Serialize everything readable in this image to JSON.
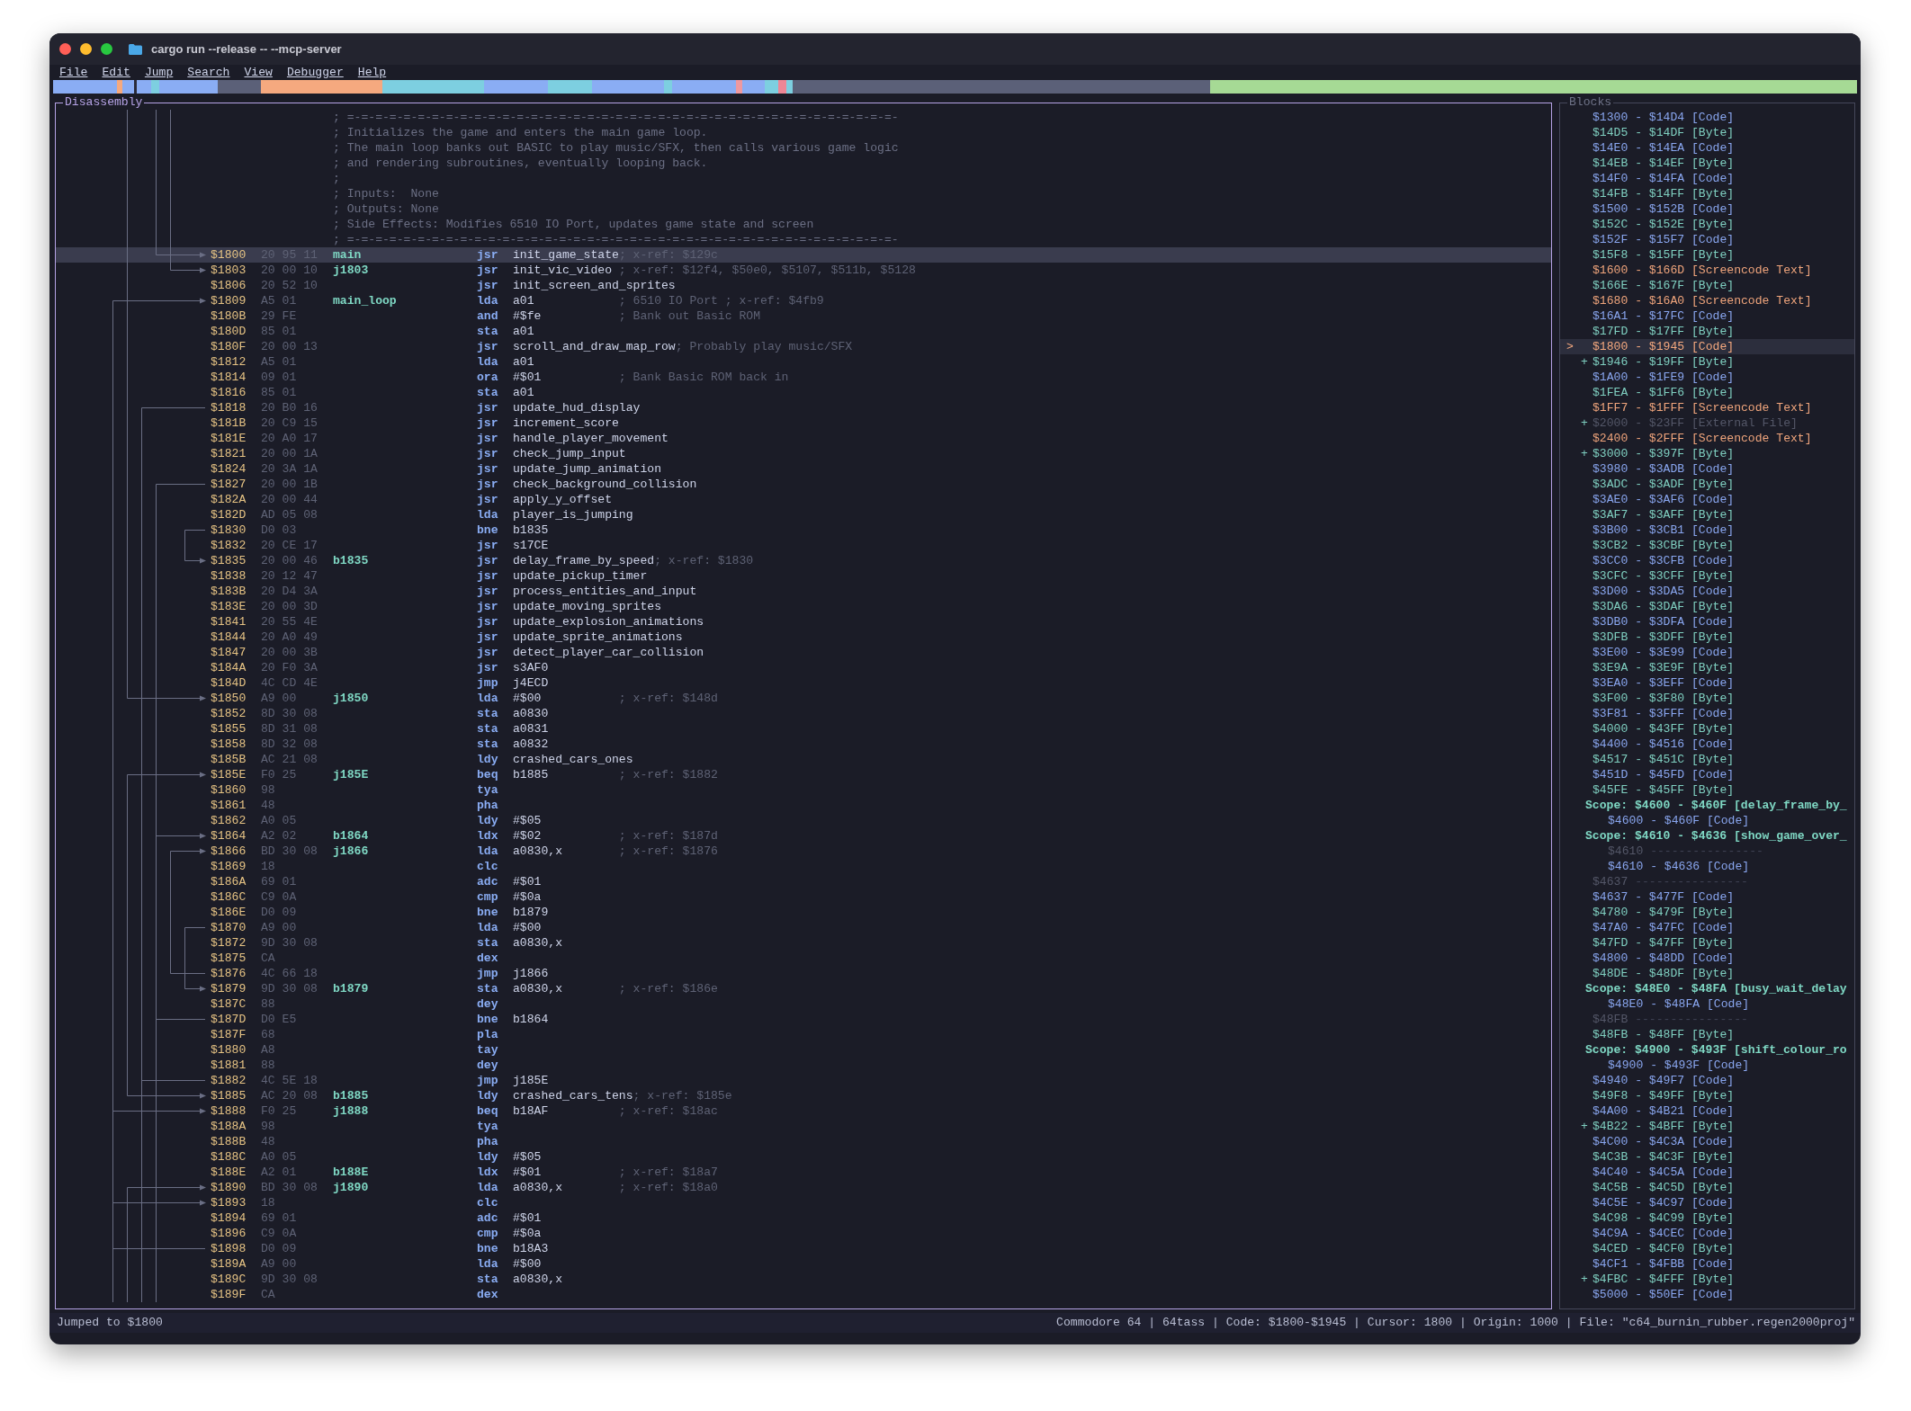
{
  "window": {
    "title": "cargo run --release -- --mcp-server"
  },
  "menu": [
    {
      "label": "File"
    },
    {
      "label": "Edit"
    },
    {
      "label": "Jump"
    },
    {
      "label": "Search"
    },
    {
      "label": "View"
    },
    {
      "label": "Debugger"
    },
    {
      "label": "Help"
    }
  ],
  "disassembly": {
    "title": "Disassembly",
    "lines": [
      {
        "kind": "comment",
        "text": "; =-=-=-=-=-=-=-=-=-=-=-=-=-=-=-=-=-=-=-=-=-=-=-=-=-=-=-=-=-=-=-=-=-=-=-=-=-=-=-"
      },
      {
        "kind": "comment",
        "text": "; Initializes the game and enters the main game loop."
      },
      {
        "kind": "comment",
        "text": "; The main loop banks out BASIC to play music/SFX, then calls various game logic"
      },
      {
        "kind": "comment",
        "text": "; and rendering subroutines, eventually looping back."
      },
      {
        "kind": "comment",
        "text": ";"
      },
      {
        "kind": "comment",
        "text": "; Inputs:  None"
      },
      {
        "kind": "comment",
        "text": "; Outputs: None"
      },
      {
        "kind": "comment",
        "text": "; Side Effects: Modifies 6510 IO Port, updates game state and screen"
      },
      {
        "kind": "comment",
        "text": "; =-=-=-=-=-=-=-=-=-=-=-=-=-=-=-=-=-=-=-=-=-=-=-=-=-=-=-=-=-=-=-=-=-=-=-=-=-=-=-"
      },
      {
        "kind": "code",
        "address": "$1800",
        "bytes": "20 95 11",
        "label": "main",
        "mnemonic": "jsr",
        "operand": "init_game_state",
        "comment": "; x-ref: $129c",
        "selected": true
      },
      {
        "kind": "code",
        "address": "$1803",
        "bytes": "20 00 10",
        "label": "j1803",
        "mnemonic": "jsr",
        "operand": "init_vic_video",
        "comment": "; x-ref: $12f4, $50e0, $5107, $511b, $5128",
        "selected": false
      },
      {
        "kind": "code",
        "address": "$1806",
        "bytes": "20 52 10",
        "mnemonic": "jsr",
        "operand": "init_screen_and_sprites",
        "selected": false
      },
      {
        "kind": "code",
        "address": "$1809",
        "bytes": "A5 01",
        "label": "main_loop",
        "mnemonic": "lda",
        "operand": "a01",
        "comment": "; 6510 IO Port ; x-ref: $4fb9",
        "selected": false
      },
      {
        "kind": "code",
        "address": "$180B",
        "bytes": "29 FE",
        "mnemonic": "and",
        "operand": "#$fe",
        "comment": "; Bank out Basic ROM",
        "selected": false
      },
      {
        "kind": "code",
        "address": "$180D",
        "bytes": "85 01",
        "mnemonic": "sta",
        "operand": "a01",
        "selected": false
      },
      {
        "kind": "code",
        "address": "$180F",
        "bytes": "20 00 13",
        "mnemonic": "jsr",
        "operand": "scroll_and_draw_map_row",
        "comment": "; Probably play music/SFX",
        "selected": false
      },
      {
        "kind": "code",
        "address": "$1812",
        "bytes": "A5 01",
        "mnemonic": "lda",
        "operand": "a01",
        "selected": false
      },
      {
        "kind": "code",
        "address": "$1814",
        "bytes": "09 01",
        "mnemonic": "ora",
        "operand": "#$01",
        "comment": "; Bank Basic ROM back in",
        "selected": false
      },
      {
        "kind": "code",
        "address": "$1816",
        "bytes": "85 01",
        "mnemonic": "sta",
        "operand": "a01",
        "selected": false
      },
      {
        "kind": "code",
        "address": "$1818",
        "bytes": "20 B0 16",
        "mnemonic": "jsr",
        "operand": "update_hud_display",
        "selected": false
      },
      {
        "kind": "code",
        "address": "$181B",
        "bytes": "20 C9 15",
        "mnemonic": "jsr",
        "operand": "increment_score",
        "selected": false
      },
      {
        "kind": "code",
        "address": "$181E",
        "bytes": "20 A0 17",
        "mnemonic": "jsr",
        "operand": "handle_player_movement",
        "selected": false
      },
      {
        "kind": "code",
        "address": "$1821",
        "bytes": "20 00 1A",
        "mnemonic": "jsr",
        "operand": "check_jump_input",
        "selected": false
      },
      {
        "kind": "code",
        "address": "$1824",
        "bytes": "20 3A 1A",
        "mnemonic": "jsr",
        "operand": "update_jump_animation",
        "selected": false
      },
      {
        "kind": "code",
        "address": "$1827",
        "bytes": "20 00 1B",
        "mnemonic": "jsr",
        "operand": "check_background_collision",
        "selected": false
      },
      {
        "kind": "code",
        "address": "$182A",
        "bytes": "20 00 44",
        "mnemonic": "jsr",
        "operand": "apply_y_offset",
        "selected": false
      },
      {
        "kind": "code",
        "address": "$182D",
        "bytes": "AD 05 08",
        "mnemonic": "lda",
        "operand": "player_is_jumping",
        "selected": false
      },
      {
        "kind": "code",
        "address": "$1830",
        "bytes": "D0 03",
        "mnemonic": "bne",
        "operand": "b1835",
        "selected": false
      },
      {
        "kind": "code",
        "address": "$1832",
        "bytes": "20 CE 17",
        "mnemonic": "jsr",
        "operand": "s17CE",
        "selected": false
      },
      {
        "kind": "code",
        "address": "$1835",
        "bytes": "20 00 46",
        "label": "b1835",
        "mnemonic": "jsr",
        "operand": "delay_frame_by_speed",
        "comment": "; x-ref: $1830",
        "selected": false
      },
      {
        "kind": "code",
        "address": "$1838",
        "bytes": "20 12 47",
        "mnemonic": "jsr",
        "operand": "update_pickup_timer",
        "selected": false
      },
      {
        "kind": "code",
        "address": "$183B",
        "bytes": "20 D4 3A",
        "mnemonic": "jsr",
        "operand": "process_entities_and_input",
        "selected": false
      },
      {
        "kind": "code",
        "address": "$183E",
        "bytes": "20 00 3D",
        "mnemonic": "jsr",
        "operand": "update_moving_sprites",
        "selected": false
      },
      {
        "kind": "code",
        "address": "$1841",
        "bytes": "20 55 4E",
        "mnemonic": "jsr",
        "operand": "update_explosion_animations",
        "selected": false
      },
      {
        "kind": "code",
        "address": "$1844",
        "bytes": "20 A0 49",
        "mnemonic": "jsr",
        "operand": "update_sprite_animations",
        "selected": false
      },
      {
        "kind": "code",
        "address": "$1847",
        "bytes": "20 00 3B",
        "mnemonic": "jsr",
        "operand": "detect_player_car_collision",
        "selected": false
      },
      {
        "kind": "code",
        "address": "$184A",
        "bytes": "20 F0 3A",
        "mnemonic": "jsr",
        "operand": "s3AF0",
        "selected": false
      },
      {
        "kind": "code",
        "address": "$184D",
        "bytes": "4C CD 4E",
        "mnemonic": "jmp",
        "operand": "j4ECD",
        "selected": false
      },
      {
        "kind": "code",
        "address": "$1850",
        "bytes": "A9 00",
        "label": "j1850",
        "mnemonic": "lda",
        "operand": "#$00",
        "comment": "; x-ref: $148d",
        "selected": false
      },
      {
        "kind": "code",
        "address": "$1852",
        "bytes": "8D 30 08",
        "mnemonic": "sta",
        "operand": "a0830",
        "selected": false
      },
      {
        "kind": "code",
        "address": "$1855",
        "bytes": "8D 31 08",
        "mnemonic": "sta",
        "operand": "a0831",
        "selected": false
      },
      {
        "kind": "code",
        "address": "$1858",
        "bytes": "8D 32 08",
        "mnemonic": "sta",
        "operand": "a0832",
        "selected": false
      },
      {
        "kind": "code",
        "address": "$185B",
        "bytes": "AC 21 08",
        "mnemonic": "ldy",
        "operand": "crashed_cars_ones",
        "selected": false
      },
      {
        "kind": "code",
        "address": "$185E",
        "bytes": "F0 25",
        "label": "j185E",
        "mnemonic": "beq",
        "operand": "b1885",
        "comment": "; x-ref: $1882",
        "selected": false
      },
      {
        "kind": "code",
        "address": "$1860",
        "bytes": "98",
        "mnemonic": "tya",
        "selected": false
      },
      {
        "kind": "code",
        "address": "$1861",
        "bytes": "48",
        "mnemonic": "pha",
        "selected": false
      },
      {
        "kind": "code",
        "address": "$1862",
        "bytes": "A0 05",
        "mnemonic": "ldy",
        "operand": "#$05",
        "selected": false
      },
      {
        "kind": "code",
        "address": "$1864",
        "bytes": "A2 02",
        "label": "b1864",
        "mnemonic": "ldx",
        "operand": "#$02",
        "comment": "; x-ref: $187d",
        "selected": false
      },
      {
        "kind": "code",
        "address": "$1866",
        "bytes": "BD 30 08",
        "label": "j1866",
        "mnemonic": "lda",
        "operand": "a0830,x",
        "comment": "; x-ref: $1876",
        "selected": false
      },
      {
        "kind": "code",
        "address": "$1869",
        "bytes": "18",
        "mnemonic": "clc",
        "selected": false
      },
      {
        "kind": "code",
        "address": "$186A",
        "bytes": "69 01",
        "mnemonic": "adc",
        "operand": "#$01",
        "selected": false
      },
      {
        "kind": "code",
        "address": "$186C",
        "bytes": "C9 0A",
        "mnemonic": "cmp",
        "operand": "#$0a",
        "selected": false
      },
      {
        "kind": "code",
        "address": "$186E",
        "bytes": "D0 09",
        "mnemonic": "bne",
        "operand": "b1879",
        "selected": false
      },
      {
        "kind": "code",
        "address": "$1870",
        "bytes": "A9 00",
        "mnemonic": "lda",
        "operand": "#$00",
        "selected": false
      },
      {
        "kind": "code",
        "address": "$1872",
        "bytes": "9D 30 08",
        "mnemonic": "sta",
        "operand": "a0830,x",
        "selected": false
      },
      {
        "kind": "code",
        "address": "$1875",
        "bytes": "CA",
        "mnemonic": "dex",
        "selected": false
      },
      {
        "kind": "code",
        "address": "$1876",
        "bytes": "4C 66 18",
        "mnemonic": "jmp",
        "operand": "j1866",
        "selected": false
      },
      {
        "kind": "code",
        "address": "$1879",
        "bytes": "9D 30 08",
        "label": "b1879",
        "mnemonic": "sta",
        "operand": "a0830,x",
        "comment": "; x-ref: $186e",
        "selected": false
      },
      {
        "kind": "code",
        "address": "$187C",
        "bytes": "88",
        "mnemonic": "dey",
        "selected": false
      },
      {
        "kind": "code",
        "address": "$187D",
        "bytes": "D0 E5",
        "mnemonic": "bne",
        "operand": "b1864",
        "selected": false
      },
      {
        "kind": "code",
        "address": "$187F",
        "bytes": "68",
        "mnemonic": "pla",
        "selected": false
      },
      {
        "kind": "code",
        "address": "$1880",
        "bytes": "A8",
        "mnemonic": "tay",
        "selected": false
      },
      {
        "kind": "code",
        "address": "$1881",
        "bytes": "88",
        "mnemonic": "dey",
        "selected": false
      },
      {
        "kind": "code",
        "address": "$1882",
        "bytes": "4C 5E 18",
        "mnemonic": "jmp",
        "operand": "j185E",
        "selected": false
      },
      {
        "kind": "code",
        "address": "$1885",
        "bytes": "AC 20 08",
        "label": "b1885",
        "mnemonic": "ldy",
        "operand": "crashed_cars_tens",
        "comment": "; x-ref: $185e",
        "selected": false
      },
      {
        "kind": "code",
        "address": "$1888",
        "bytes": "F0 25",
        "label": "j1888",
        "mnemonic": "beq",
        "operand": "b18AF",
        "comment": "; x-ref: $18ac",
        "selected": false
      },
      {
        "kind": "code",
        "address": "$188A",
        "bytes": "98",
        "mnemonic": "tya",
        "selected": false
      },
      {
        "kind": "code",
        "address": "$188B",
        "bytes": "48",
        "mnemonic": "pha",
        "selected": false
      },
      {
        "kind": "code",
        "address": "$188C",
        "bytes": "A0 05",
        "mnemonic": "ldy",
        "operand": "#$05",
        "selected": false
      },
      {
        "kind": "code",
        "address": "$188E",
        "bytes": "A2 01",
        "label": "b188E",
        "mnemonic": "ldx",
        "operand": "#$01",
        "comment": "; x-ref: $18a7",
        "selected": false
      },
      {
        "kind": "code",
        "address": "$1890",
        "bytes": "BD 30 08",
        "label": "j1890",
        "mnemonic": "lda",
        "operand": "a0830,x",
        "comment": "; x-ref: $18a0",
        "selected": false
      },
      {
        "kind": "code",
        "address": "$1893",
        "bytes": "18",
        "mnemonic": "clc",
        "selected": false
      },
      {
        "kind": "code",
        "address": "$1894",
        "bytes": "69 01",
        "mnemonic": "adc",
        "operand": "#$01",
        "selected": false
      },
      {
        "kind": "code",
        "address": "$1896",
        "bytes": "C9 0A",
        "mnemonic": "cmp",
        "operand": "#$0a",
        "selected": false
      },
      {
        "kind": "code",
        "address": "$1898",
        "bytes": "D0 09",
        "mnemonic": "bne",
        "operand": "b18A3",
        "selected": false
      },
      {
        "kind": "code",
        "address": "$189A",
        "bytes": "A9 00",
        "mnemonic": "lda",
        "operand": "#$00",
        "selected": false
      },
      {
        "kind": "code",
        "address": "$189C",
        "bytes": "9D 30 08",
        "mnemonic": "sta",
        "operand": "a0830,x",
        "selected": false
      },
      {
        "kind": "code",
        "address": "$189F",
        "bytes": "CA",
        "mnemonic": "dex",
        "selected": false
      }
    ]
  },
  "blocks": {
    "title": "Blocks",
    "items": [
      {
        "kind": "code",
        "text": "$1300 - $14D4 [Code]",
        "selected": false
      },
      {
        "kind": "byte",
        "text": "$14D5 - $14DF [Byte]",
        "selected": false
      },
      {
        "kind": "code",
        "text": "$14E0 - $14EA [Code]",
        "selected": false
      },
      {
        "kind": "byte",
        "text": "$14EB - $14EF [Byte]",
        "selected": false
      },
      {
        "kind": "code",
        "text": "$14F0 - $14FA [Code]",
        "selected": false
      },
      {
        "kind": "byte",
        "text": "$14FB - $14FF [Byte]",
        "selected": false
      },
      {
        "kind": "code",
        "text": "$1500 - $152B [Code]",
        "selected": false
      },
      {
        "kind": "byte",
        "text": "$152C - $152E [Byte]",
        "selected": false
      },
      {
        "kind": "code",
        "text": "$152F - $15F7 [Code]",
        "selected": false
      },
      {
        "kind": "byte",
        "text": "$15F8 - $15FF [Byte]",
        "selected": false
      },
      {
        "kind": "text",
        "text": "$1600 - $166D [Screencode Text]",
        "selected": false
      },
      {
        "kind": "byte",
        "text": "$166E - $167F [Byte]",
        "selected": false
      },
      {
        "kind": "text",
        "text": "$1680 - $16A0 [Screencode Text]",
        "selected": false
      },
      {
        "kind": "code",
        "text": "$16A1 - $17FC [Code]",
        "selected": false
      },
      {
        "kind": "byte",
        "text": "$17FD - $17FF [Byte]",
        "selected": false
      },
      {
        "kind": "code",
        "text": "$1800 - $1945 [Code]",
        "cursor": ">",
        "selected": true
      },
      {
        "kind": "byte",
        "text": "$1946 - $19FF [Byte]",
        "toggle": "+",
        "selected": false
      },
      {
        "kind": "code",
        "text": "$1A00 - $1FE9 [Code]",
        "selected": false
      },
      {
        "kind": "byte",
        "text": "$1FEA - $1FF6 [Byte]",
        "selected": false
      },
      {
        "kind": "text",
        "text": "$1FF7 - $1FFF [Screencode Text]",
        "selected": false
      },
      {
        "kind": "external",
        "text": "$2000 - $23FF [External File]",
        "toggle": "+",
        "selected": false
      },
      {
        "kind": "text",
        "text": "$2400 - $2FFF [Screencode Text]",
        "selected": false
      },
      {
        "kind": "byte",
        "text": "$3000 - $397F [Byte]",
        "toggle": "+",
        "selected": false
      },
      {
        "kind": "code",
        "text": "$3980 - $3ADB [Code]",
        "selected": false
      },
      {
        "kind": "byte",
        "text": "$3ADC - $3ADF [Byte]",
        "selected": false
      },
      {
        "kind": "code",
        "text": "$3AE0 - $3AF6 [Code]",
        "selected": false
      },
      {
        "kind": "byte",
        "text": "$3AF7 - $3AFF [Byte]",
        "selected": false
      },
      {
        "kind": "code",
        "text": "$3B00 - $3CB1 [Code]",
        "selected": false
      },
      {
        "kind": "byte",
        "text": "$3CB2 - $3CBF [Byte]",
        "selected": false
      },
      {
        "kind": "code",
        "text": "$3CC0 - $3CFB [Code]",
        "selected": false
      },
      {
        "kind": "byte",
        "text": "$3CFC - $3CFF [Byte]",
        "selected": false
      },
      {
        "kind": "code",
        "text": "$3D00 - $3DA5 [Code]",
        "selected": false
      },
      {
        "kind": "byte",
        "text": "$3DA6 - $3DAF [Byte]",
        "selected": false
      },
      {
        "kind": "code",
        "text": "$3DB0 - $3DFA [Code]",
        "selected": false
      },
      {
        "kind": "byte",
        "text": "$3DFB - $3DFF [Byte]",
        "selected": false
      },
      {
        "kind": "code",
        "text": "$3E00 - $3E99 [Code]",
        "selected": false
      },
      {
        "kind": "byte",
        "text": "$3E9A - $3E9F [Byte]",
        "selected": false
      },
      {
        "kind": "code",
        "text": "$3EA0 - $3EFF [Code]",
        "selected": false
      },
      {
        "kind": "byte",
        "text": "$3F00 - $3F80 [Byte]",
        "selected": false
      },
      {
        "kind": "code",
        "text": "$3F81 - $3FFF [Code]",
        "selected": false
      },
      {
        "kind": "byte",
        "text": "$4000 - $43FF [Byte]",
        "selected": false
      },
      {
        "kind": "code",
        "text": "$4400 - $4516 [Code]",
        "selected": false
      },
      {
        "kind": "byte",
        "text": "$4517 - $451C [Byte]",
        "selected": false
      },
      {
        "kind": "code",
        "text": "$451D - $45FD [Code]",
        "selected": false
      },
      {
        "kind": "byte",
        "text": "$45FE - $45FF [Byte]",
        "selected": false
      },
      {
        "kind": "scope",
        "text": "Scope: $4600 - $460F [delay_frame_by_",
        "selected": false,
        "children": [
          {
            "kind": "code",
            "text": "$4600 - $460F [Code]",
            "selected": false
          }
        ]
      },
      {
        "kind": "scope",
        "text": "Scope: $4610 - $4636 [show_game_over_",
        "selected": false,
        "children": [
          {
            "kind": "gap",
            "text": "$4610",
            "rule": "----------------",
            "selected": false
          },
          {
            "kind": "code",
            "text": "$4610 - $4636 [Code]",
            "selected": false
          }
        ]
      },
      {
        "kind": "gap",
        "text": "$4637",
        "rule": "----------------",
        "selected": false
      },
      {
        "kind": "code",
        "text": "$4637 - $477F [Code]",
        "selected": false
      },
      {
        "kind": "byte",
        "text": "$4780 - $479F [Byte]",
        "selected": false
      },
      {
        "kind": "code",
        "text": "$47A0 - $47FC [Code]",
        "selected": false
      },
      {
        "kind": "byte",
        "text": "$47FD - $47FF [Byte]",
        "selected": false
      },
      {
        "kind": "code",
        "text": "$4800 - $48DD [Code]",
        "selected": false
      },
      {
        "kind": "byte",
        "text": "$48DE - $48DF [Byte]",
        "selected": false
      },
      {
        "kind": "scope",
        "text": "Scope: $48E0 - $48FA [busy_wait_delay",
        "selected": false,
        "children": [
          {
            "kind": "code",
            "text": "$48E0 - $48FA [Code]",
            "selected": false
          }
        ]
      },
      {
        "kind": "gap",
        "text": "$48FB",
        "rule": "----------------",
        "selected": false
      },
      {
        "kind": "byte",
        "text": "$48FB - $48FF [Byte]",
        "selected": false
      },
      {
        "kind": "scope",
        "text": "Scope: $4900 - $493F [shift_colour_ro",
        "selected": false,
        "children": [
          {
            "kind": "code",
            "text": "$4900 - $493F [Code]",
            "selected": false
          }
        ]
      },
      {
        "kind": "code",
        "text": "$4940 - $49F7 [Code]",
        "selected": false
      },
      {
        "kind": "byte",
        "text": "$49F8 - $49FF [Byte]",
        "selected": false
      },
      {
        "kind": "code",
        "text": "$4A00 - $4B21 [Code]",
        "selected": false
      },
      {
        "kind": "byte",
        "text": "$4B22 - $4BFF [Byte]",
        "toggle": "+",
        "selected": false
      },
      {
        "kind": "code",
        "text": "$4C00 - $4C3A [Code]",
        "selected": false
      },
      {
        "kind": "byte",
        "text": "$4C3B - $4C3F [Byte]",
        "selected": false
      },
      {
        "kind": "code",
        "text": "$4C40 - $4C5A [Code]",
        "selected": false
      },
      {
        "kind": "byte",
        "text": "$4C5B - $4C5D [Byte]",
        "selected": false
      },
      {
        "kind": "code",
        "text": "$4C5E - $4C97 [Code]",
        "selected": false
      },
      {
        "kind": "byte",
        "text": "$4C98 - $4C99 [Byte]",
        "selected": false
      },
      {
        "kind": "code",
        "text": "$4C9A - $4CEC [Code]",
        "selected": false
      },
      {
        "kind": "byte",
        "text": "$4CED - $4CF0 [Byte]",
        "selected": false
      },
      {
        "kind": "code",
        "text": "$4CF1 - $4FBB [Code]",
        "selected": false
      },
      {
        "kind": "byte",
        "text": "$4FBC - $4FFF [Byte]",
        "toggle": "+",
        "selected": false
      },
      {
        "kind": "code",
        "text": "$5000 - $50EF [Code]",
        "selected": false
      }
    ]
  },
  "status_bar": {
    "message": "Jumped to $1800",
    "info": "Commodore 64 | 64tass | Code: $1800-$1945 | Cursor: 1800 | Origin: 1000 | File: \"c64_burnin_rubber.regen2000proj\""
  }
}
